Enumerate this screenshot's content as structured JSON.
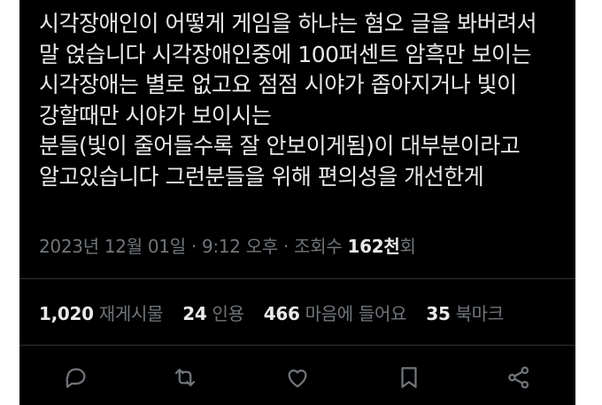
{
  "tweet": {
    "lines": [
      "시각장애인이 어떻게 게임을 하냐는 혐오 글을 봐버려서",
      "말 얹습니다 시각장애인중에 100퍼센트 암흑만 보이는",
      "시각장애는 별로 없고요 점점 시야가 좁아지거나 빛이",
      "강할때만 시야가 보이시는",
      "분들(빛이 줄어들수록 잘 안보이게됨)이 대부분이라고",
      "알고있습니다 그런분들을 위해 편의성을 개선한게"
    ]
  },
  "meta": {
    "date": "2023년 12월 01일",
    "sep1": " · ",
    "time": "9:12 오후",
    "sep2": " · ",
    "views_label": "조회수 ",
    "views_count": "162천",
    "views_suffix": "회"
  },
  "stats": {
    "retweets": {
      "count": "1,020",
      "label": "재게시물"
    },
    "quotes": {
      "count": "24",
      "label": "인용"
    },
    "likes": {
      "count": "466",
      "label": "마음에 들어요"
    },
    "bookmarks": {
      "count": "35",
      "label": "북마크"
    }
  },
  "actions": [
    "reply-icon",
    "retweet-icon",
    "like-icon",
    "bookmark-icon",
    "share-icon"
  ],
  "colors": {
    "background": "#000000",
    "text": "#e7e9ea",
    "muted": "#71767b",
    "divider": "#2f3336"
  }
}
